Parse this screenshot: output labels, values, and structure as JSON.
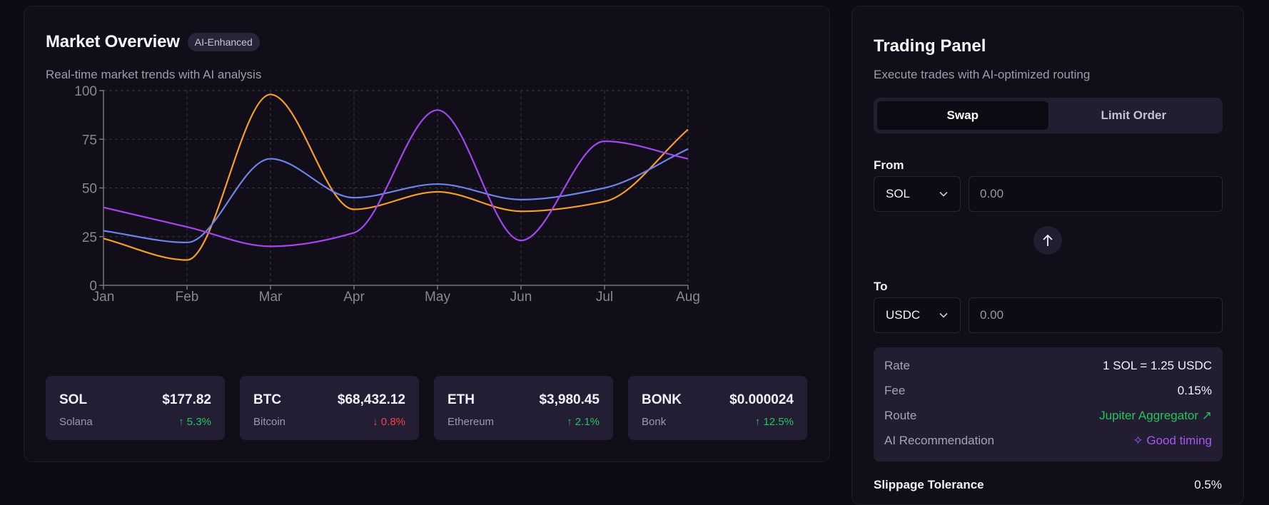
{
  "market": {
    "title": "Market Overview",
    "badge": "AI-Enhanced",
    "subtitle": "Real-time market trends with AI analysis"
  },
  "chart_data": {
    "type": "line",
    "categories": [
      "Jan",
      "Feb",
      "Mar",
      "Apr",
      "May",
      "Jun",
      "Jul",
      "Aug"
    ],
    "ylim": [
      0,
      100
    ],
    "yticks": [
      0,
      25,
      50,
      75,
      100
    ],
    "grid": true,
    "series": [
      {
        "values": [
          24,
          13,
          98,
          39,
          48,
          38,
          43,
          80
        ],
        "color": "#f59e2a"
      },
      {
        "values": [
          28,
          22,
          65,
          45,
          52,
          44,
          50,
          70
        ],
        "color": "#6d83e8"
      },
      {
        "values": [
          40,
          30,
          20,
          27,
          90,
          23,
          74,
          65
        ],
        "color": "#a347f0"
      }
    ]
  },
  "coins": [
    {
      "symbol": "SOL",
      "name": "Solana",
      "price": "$177.82",
      "change": "↑ 5.3%",
      "direction": "up"
    },
    {
      "symbol": "BTC",
      "name": "Bitcoin",
      "price": "$68,432.12",
      "change": "↓ 0.8%",
      "direction": "down"
    },
    {
      "symbol": "ETH",
      "name": "Ethereum",
      "price": "$3,980.45",
      "change": "↑ 2.1%",
      "direction": "up"
    },
    {
      "symbol": "BONK",
      "name": "Bonk",
      "price": "$0.000024",
      "change": "↑ 12.5%",
      "direction": "up"
    }
  ],
  "trading": {
    "title": "Trading Panel",
    "subtitle": "Execute trades with AI-optimized routing",
    "tabs": [
      {
        "label": "Swap",
        "active": true
      },
      {
        "label": "Limit Order",
        "active": false
      }
    ],
    "from": {
      "label": "From",
      "token": "SOL",
      "placeholder": "0.00"
    },
    "to": {
      "label": "To",
      "token": "USDC",
      "placeholder": "0.00"
    },
    "info": [
      {
        "key": "Rate",
        "value": "1 SOL = 1.25 USDC"
      },
      {
        "key": "Fee",
        "value": "0.15%"
      },
      {
        "key": "Route",
        "value": "Jupiter Aggregator ↗"
      },
      {
        "key": "AI Recommendation",
        "value": "✧ Good timing"
      }
    ],
    "slippage_label": "Slippage Tolerance",
    "slippage_value": "0.5%"
  },
  "colors": {
    "up": "#22c55e",
    "down": "#ef4444",
    "accent_purple": "#a855f7"
  }
}
